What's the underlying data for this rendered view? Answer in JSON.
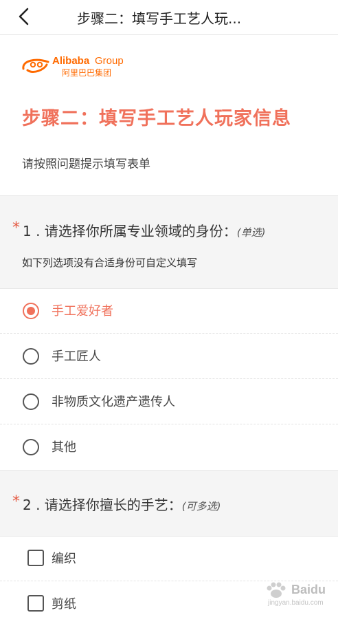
{
  "header": {
    "title": "步骤二：填写手工艺人玩...",
    "back_icon": "chevron-left-icon"
  },
  "logo": {
    "brand_en": "Alibaba",
    "brand_group": "Group",
    "brand_cn": "阿里巴巴集团",
    "color": "#ff6a00"
  },
  "page": {
    "title": "步骤二：填写手工艺人玩家信息",
    "intro": "请按照问题提示填写表单",
    "accent_color": "#f0715b"
  },
  "questions": [
    {
      "required_mark": "*",
      "label": "1 . 请选择你所属专业领域的身份：",
      "type": "(单选)",
      "hint": "如下列选项没有合适身份可自定义填写",
      "options": [
        {
          "label": "手工爱好者",
          "selected": true
        },
        {
          "label": "手工匠人",
          "selected": false
        },
        {
          "label": "非物质文化遗产遗传人",
          "selected": false
        },
        {
          "label": "其他",
          "selected": false
        }
      ]
    },
    {
      "required_mark": "*",
      "label": "2 . 请选择你擅长的手艺：",
      "type": "(可多选)",
      "options": [
        {
          "label": "编织",
          "checked": false
        },
        {
          "label": "剪纸",
          "checked": false
        }
      ]
    }
  ],
  "watermark": {
    "text": "Baidu",
    "sub": "jingyan.baidu.com"
  }
}
